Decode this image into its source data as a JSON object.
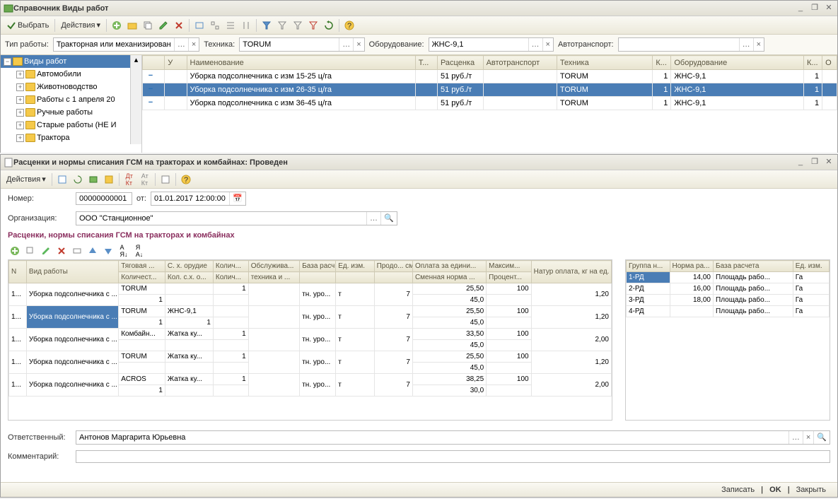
{
  "win1": {
    "title": "Справочник Виды работ",
    "toolbar": {
      "select": "Выбрать",
      "actions": "Действия"
    },
    "filters": {
      "type_label": "Тип работы:",
      "type_value": "Тракторная или механизированная",
      "tech_label": "Техника:",
      "tech_value": "TORUM",
      "equip_label": "Оборудование:",
      "equip_value": "ЖНС-9,1",
      "auto_label": "Автотранспорт:",
      "auto_value": ""
    },
    "tree": [
      "Виды работ",
      "Автомобили",
      "Животноводство",
      "Работы с 1 апреля 20",
      "Ручные работы",
      "Старые работы (НЕ И",
      "Трактора"
    ],
    "grid": {
      "cols": [
        "",
        "У",
        "Наименование",
        "Т...",
        "Расценка",
        "Автотранспорт",
        "Техника",
        "К...",
        "Оборудование",
        "К...",
        "О"
      ],
      "rows": [
        {
          "name": "Уборка подсолнечника с изм 15-25 ц/га",
          "price": "51 руб./т",
          "tech": "TORUM",
          "k1": "1",
          "equip": "ЖНС-9,1",
          "k2": "1",
          "sel": false
        },
        {
          "name": "Уборка подсолнечника с изм 26-35 ц/га",
          "price": "51 руб./т",
          "tech": "TORUM",
          "k1": "1",
          "equip": "ЖНС-9,1",
          "k2": "1",
          "sel": true
        },
        {
          "name": "Уборка подсолнечника с изм 36-45 ц/га",
          "price": "51 руб./т",
          "tech": "TORUM",
          "k1": "1",
          "equip": "ЖНС-9,1",
          "k2": "1",
          "sel": false
        }
      ]
    }
  },
  "win2": {
    "title": "Расценки и нормы списания ГСМ на тракторах и комбайнах: Проведен",
    "toolbar": {
      "actions": "Действия"
    },
    "number_label": "Номер:",
    "number_value": "00000000001",
    "from_label": "от:",
    "date_value": "01.01.2017 12:00:00",
    "org_label": "Организация:",
    "org_value": "ООО \"Станционное\"",
    "section": "Расценки, нормы списания ГСМ на тракторах и комбайнах",
    "grid": {
      "h1": [
        "N",
        "Вид работы",
        "Тяговая ...",
        "С. х. орудие",
        "Колич...",
        "Обслужива...",
        "База расч...",
        "Ед. изм.",
        "Продо... смен...",
        "Оплата за едини...",
        "Максим...",
        "Натур оплата, кг на ед. изм."
      ],
      "h2": [
        "",
        "",
        "Количест...",
        "Кол. с.х. о...",
        "Колич...",
        "техника и ...",
        "",
        "",
        "",
        "Сменная норма ...",
        "Процент...",
        ""
      ],
      "rows": [
        {
          "n": "1...",
          "work": "Уборка подсолнечника с ...",
          "tech": "TORUM",
          "tech_qty": "1",
          "tool": "",
          "tool_qty": "",
          "qty": "1",
          "base": "тн. уро...",
          "unit": "т",
          "prod": "7",
          "pay": "25,50",
          "norm": "45,0",
          "max": "100",
          "pct": "",
          "natur": "1,20",
          "sel": false
        },
        {
          "n": "1...",
          "work": "Уборка подсолнечника с ...",
          "tech": "TORUM",
          "tech_qty": "1",
          "tool": "ЖНС-9,1",
          "tool_qty": "1",
          "qty": "",
          "base": "тн. уро...",
          "unit": "т",
          "prod": "7",
          "pay": "25,50",
          "norm": "45,0",
          "max": "100",
          "pct": "",
          "natur": "1,20",
          "sel": true
        },
        {
          "n": "1...",
          "work": "Уборка подсолнечника с ...",
          "tech": "Комбайн...",
          "tech_qty": "",
          "tool": "Жатка ку...",
          "tool_qty": "",
          "qty": "1",
          "base": "тн. уро...",
          "unit": "т",
          "prod": "7",
          "pay": "33,50",
          "norm": "45,0",
          "max": "100",
          "pct": "",
          "natur": "2,00",
          "sel": false
        },
        {
          "n": "1...",
          "work": "Уборка подсолнечника с ...",
          "tech": "TORUM",
          "tech_qty": "",
          "tool": "Жатка ку...",
          "tool_qty": "",
          "qty": "1",
          "base": "тн. уро...",
          "unit": "т",
          "prod": "7",
          "pay": "25,50",
          "norm": "45,0",
          "max": "100",
          "pct": "",
          "natur": "1,20",
          "sel": false
        },
        {
          "n": "1...",
          "work": "Уборка подсолнечника с ...",
          "tech": "ACROS",
          "tech_qty": "1",
          "tool": "Жатка ку...",
          "tool_qty": "",
          "qty": "1",
          "base": "тн. уро...",
          "unit": "т",
          "prod": "7",
          "pay": "38,25",
          "norm": "30,0",
          "max": "100",
          "pct": "",
          "natur": "2,00",
          "sel": false
        }
      ]
    },
    "side": {
      "cols": [
        "Группа н...",
        "Норма ра...",
        "База расчета",
        "Ед. изм."
      ],
      "rows": [
        {
          "g": "1-РД",
          "n": "14,00",
          "b": "Площадь рабо...",
          "u": "Га",
          "sel": true
        },
        {
          "g": "2-РД",
          "n": "16,00",
          "b": "Площадь рабо...",
          "u": "Га",
          "sel": false
        },
        {
          "g": "3-РД",
          "n": "18,00",
          "b": "Площадь рабо...",
          "u": "Га",
          "sel": false
        },
        {
          "g": "4-РД",
          "n": "",
          "b": "Площадь рабо...",
          "u": "Га",
          "sel": false
        }
      ]
    },
    "resp_label": "Ответственный:",
    "resp_value": "Антонов Маргарита Юрьевна",
    "comment_label": "Комментарий:",
    "comment_value": "",
    "footer": {
      "save": "Записать",
      "ok": "OK",
      "close": "Закрыть"
    }
  }
}
